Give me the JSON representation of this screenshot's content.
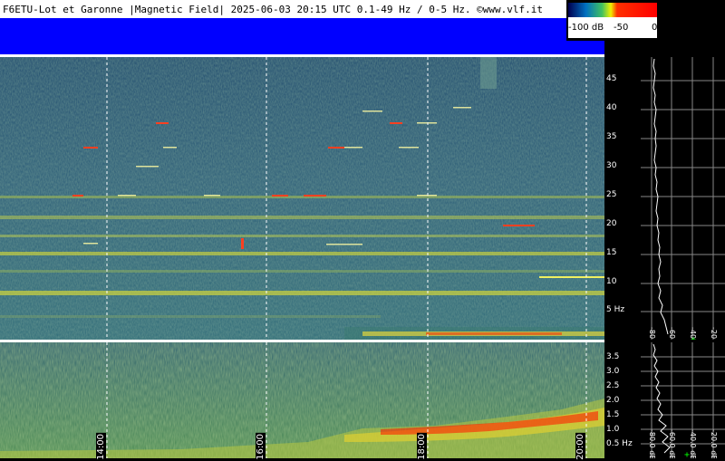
{
  "header": {
    "title": "F6ETU-Lot et Garonne |Magnetic Field| 2025-06-03 20:15 UTC 0.1-49 Hz / 0-5 Hz. ©www.vlf.it"
  },
  "colorbar": {
    "labels": [
      "-100 dB",
      "-50",
      "0"
    ],
    "colors": [
      "#000080",
      "#0090c0",
      "#40c040",
      "#ffff00",
      "#ff6000",
      "#ff0000"
    ]
  },
  "axes": {
    "top_hz_ticks": [
      "45",
      "40",
      "35",
      "30",
      "25",
      "20",
      "15",
      "10",
      "5 Hz"
    ],
    "bottom_hz_ticks": [
      "3.5",
      "3.0",
      "2.5",
      "2.0",
      "1.5",
      "1.0",
      "0.5 Hz"
    ],
    "time_ticks": [
      "14:00",
      "16:00",
      "18:00",
      "20:00"
    ],
    "db_labels": [
      "-80.0 dB",
      "-60.0 dB",
      "-40.0 dB",
      "-20.0 dB"
    ]
  },
  "colors": {
    "background": "#000000",
    "title_bg": "#ffffff",
    "blue_band": "#0000ff",
    "spectrogram_base": "#2a5a78",
    "band_yellow": "#c8d040",
    "signal_red": "#ff2000"
  }
}
